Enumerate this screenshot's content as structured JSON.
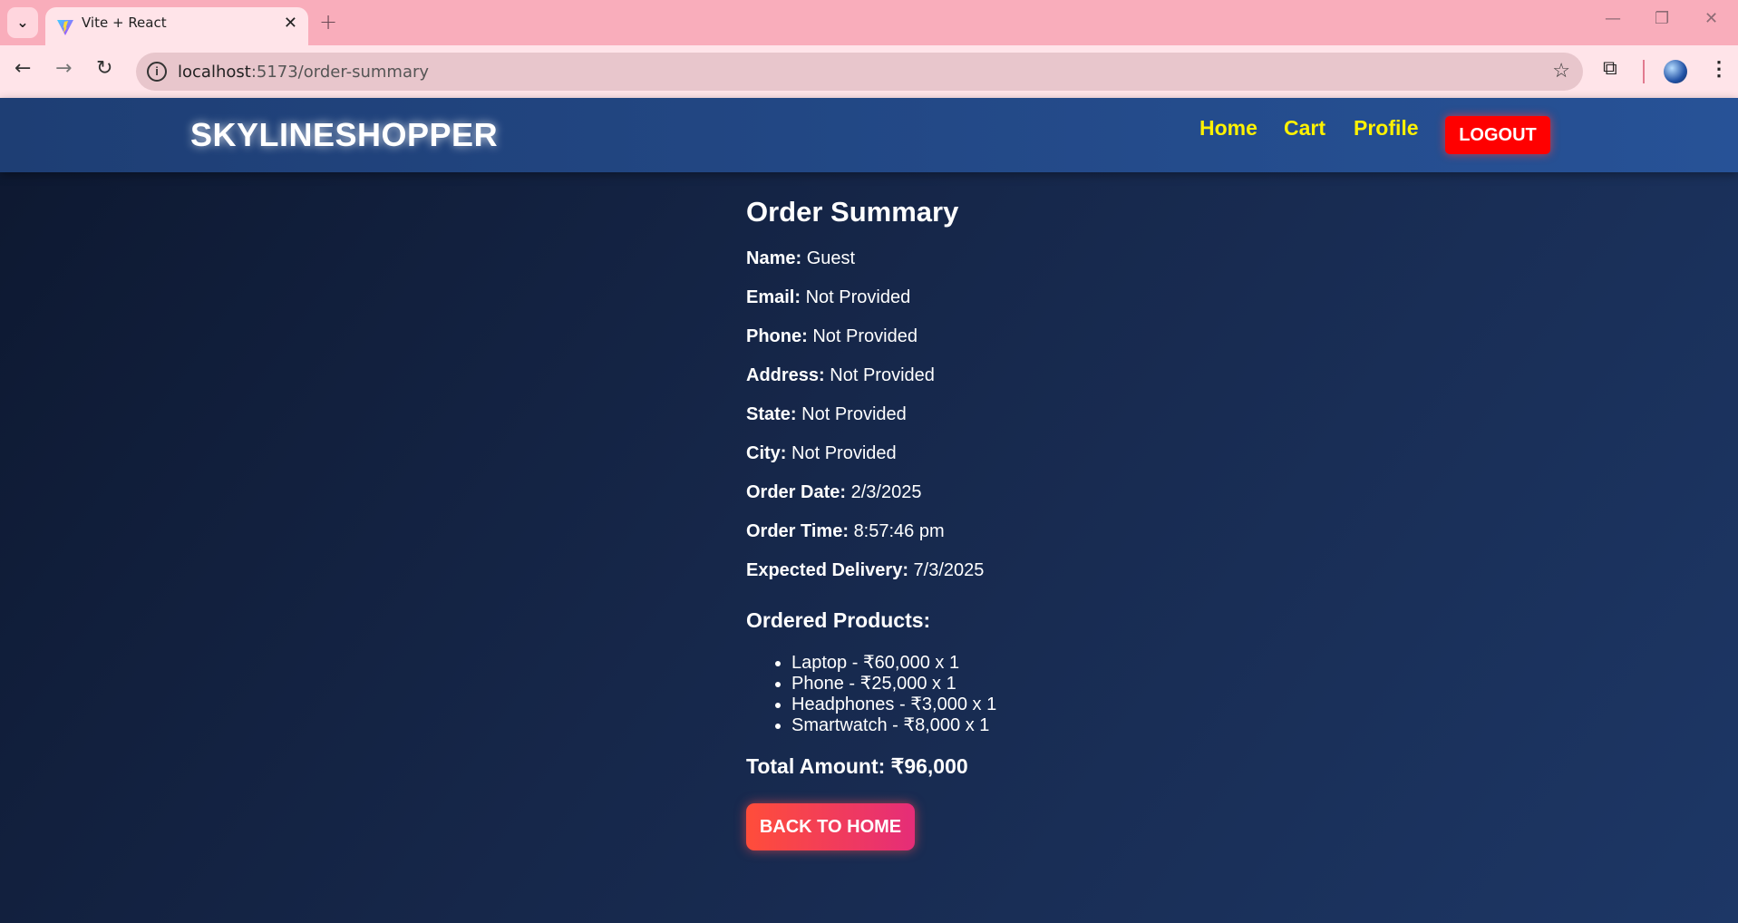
{
  "browser": {
    "tab_title": "Vite + React",
    "tab_close": "✕",
    "new_tab": "+",
    "url_host": "localhost",
    "url_path": ":5173/order-summary",
    "controls": {
      "minimize": "—",
      "restore": "❐",
      "close": "✕"
    },
    "icons": {
      "back": "←",
      "forward": "→",
      "reload": "↻",
      "info": "i",
      "star": "☆",
      "extensions": "⧉",
      "menu": "⋮",
      "tab_list": "⌄"
    }
  },
  "navbar": {
    "brand": "SKYLINESHOPPER",
    "links": [
      "Home",
      "Cart",
      "Profile"
    ],
    "logout": "LOGOUT",
    "link_color": "#fff200",
    "logout_color": "#ff0000"
  },
  "summary": {
    "title": "Order Summary",
    "fields": [
      {
        "label": "Name:",
        "value": "Guest"
      },
      {
        "label": "Email:",
        "value": "Not Provided"
      },
      {
        "label": "Phone:",
        "value": "Not Provided"
      },
      {
        "label": "Address:",
        "value": "Not Provided"
      },
      {
        "label": "State:",
        "value": "Not Provided"
      },
      {
        "label": "City:",
        "value": "Not Provided"
      },
      {
        "label": "Order Date:",
        "value": "2/3/2025"
      },
      {
        "label": "Order Time:",
        "value": "8:57:46 pm"
      },
      {
        "label": "Expected Delivery:",
        "value": "7/3/2025"
      }
    ],
    "products_heading": "Ordered Products:",
    "products": [
      "Laptop - ₹60,000 x 1",
      "Phone - ₹25,000 x 1",
      "Headphones - ₹3,000 x 1",
      "Smartwatch - ₹8,000 x 1"
    ],
    "total": "Total Amount: ₹96,000",
    "back_button": "BACK TO HOME"
  }
}
